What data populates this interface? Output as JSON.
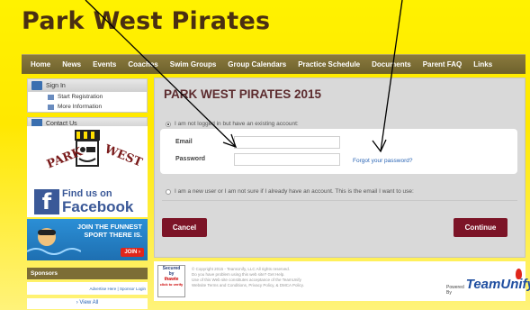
{
  "header": {
    "site_title": "Park West Pirates"
  },
  "nav": {
    "items": [
      "Home",
      "News",
      "Events",
      "Coaches",
      "Swim Groups",
      "Group Calendars",
      "Practice Schedule",
      "Documents",
      "Parent FAQ",
      "Links"
    ]
  },
  "sidebar": {
    "sign_in": "Sign In",
    "start_registration": "Start Registration",
    "more_information": "More Information",
    "contact_us": "Contact Us",
    "logo_text_left": "PARK",
    "logo_text_right": "WEST",
    "facebook_small": "Find us on",
    "facebook_big": "Facebook",
    "ad_line1": "JOIN THE FUNNEST",
    "ad_line2": "SPORT THERE IS.",
    "ad_join": "JOIN ›"
  },
  "main": {
    "title": "PARK WEST PIRATES 2015",
    "existing_account": "I am not logged in but have an existing account:",
    "email_label": "Email",
    "password_label": "Password",
    "forgot_password": "Forgot your password?",
    "new_user": "I am a new user or I am not sure if I already have an account. This is the email I want to use:",
    "cancel_button": "Cancel",
    "continue_button": "Continue"
  },
  "footer": {
    "sponsors_title": "Sponsors",
    "advertise": "Advertise Here | Sponsor Login",
    "view_all": "› View All",
    "secured_line1": "Secured",
    "secured_line2": "by",
    "secured_line3": "thawte",
    "secured_line4": "click to verify",
    "copyright_1": "© Copyright 2015 - TeamUnify, LLC All rights reserved.",
    "copyright_2": "Do you have problem using this web site? Get Help.",
    "copyright_3": "Use of this Web site constitutes acceptance of the TeamUnify",
    "copyright_4": "Website Terms and Conditions, Privacy Policy, & DMCA Policy.",
    "powered_by": "Powered By",
    "brand": "TeamUnify"
  },
  "colors": {
    "accent": "#7c1427",
    "nav": "#7c6d36",
    "link": "#2a65b5",
    "background": "#fff200"
  }
}
